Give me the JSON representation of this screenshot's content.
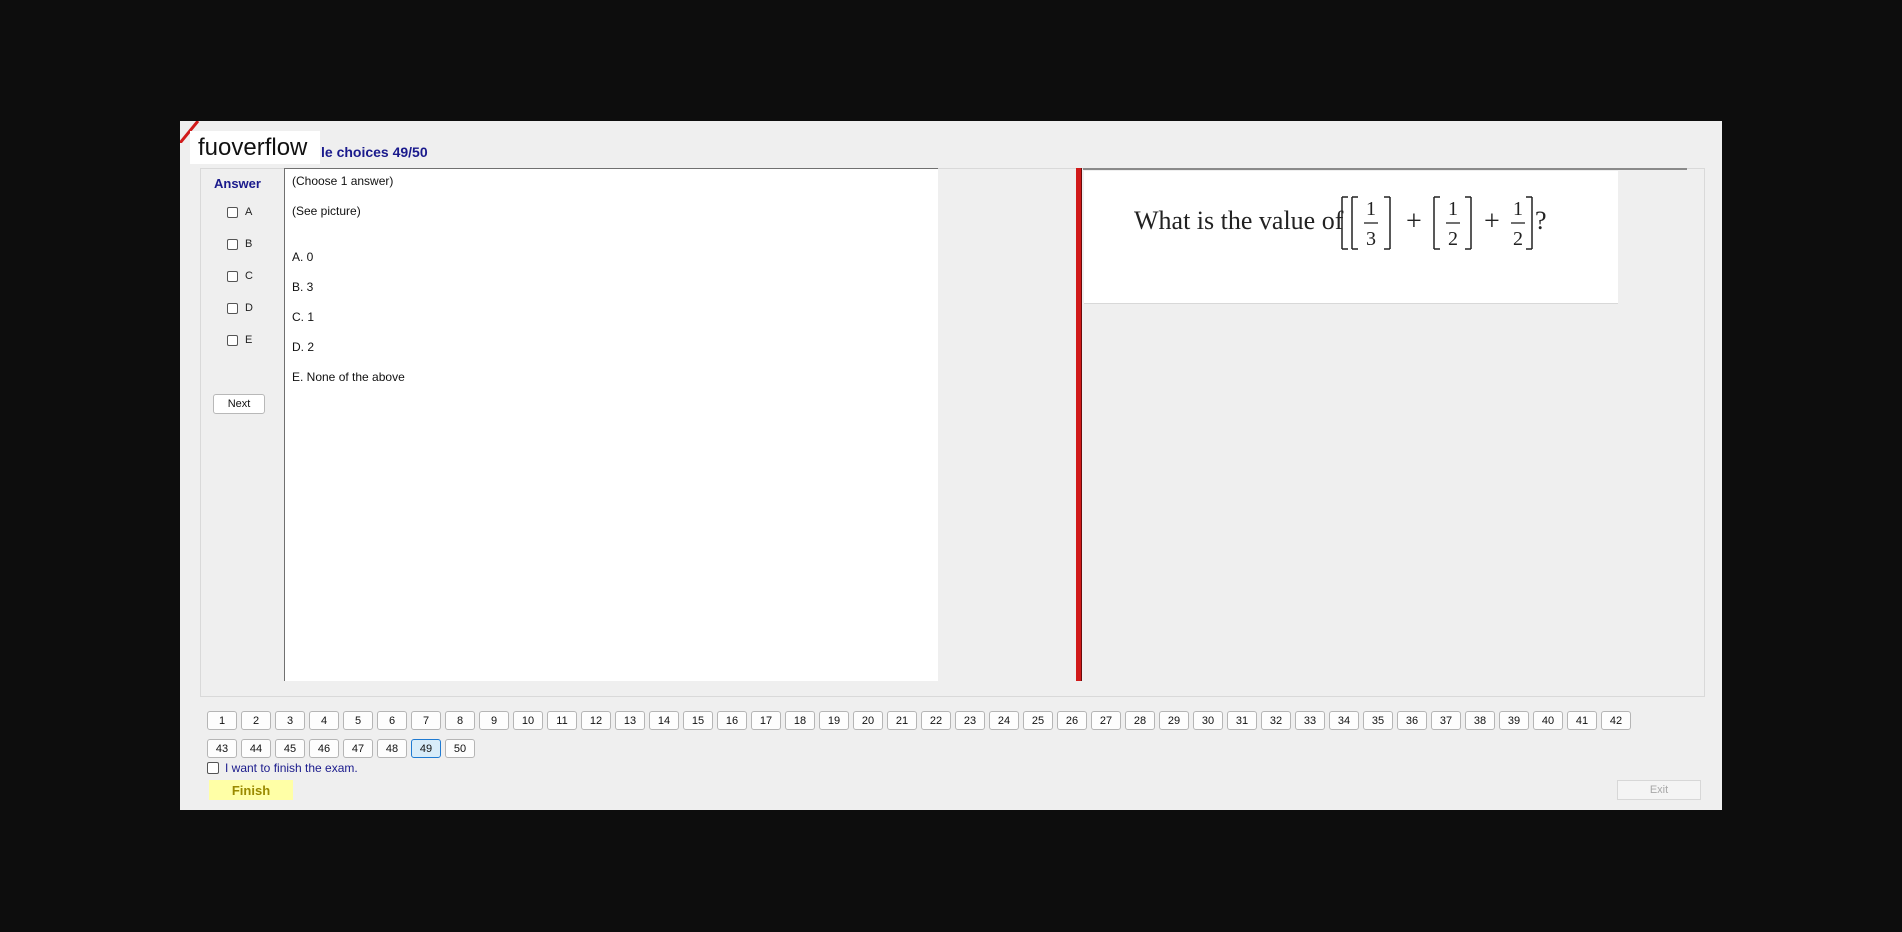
{
  "brand": {
    "text": "fuoverflow"
  },
  "header": {
    "title": "le choices 49/50"
  },
  "answer_panel": {
    "heading": "Answer",
    "options": [
      "A",
      "B",
      "C",
      "D",
      "E"
    ],
    "next_label": "Next"
  },
  "question": {
    "lines": [
      "(Choose 1 answer)",
      "(See picture)",
      "A.  0",
      "B.  3",
      "C.  1",
      "D.  2",
      "E.  None of the above"
    ]
  },
  "image": {
    "prefix": "What is the value of",
    "terms": [
      {
        "num": "1",
        "den": "3"
      },
      {
        "num": "1",
        "den": "2"
      },
      {
        "num": "1",
        "den": "2"
      }
    ],
    "plus": "+",
    "suffix": "?"
  },
  "navigation": {
    "numbers": [
      "1",
      "2",
      "3",
      "4",
      "5",
      "6",
      "7",
      "8",
      "9",
      "10",
      "11",
      "12",
      "13",
      "14",
      "15",
      "16",
      "17",
      "18",
      "19",
      "20",
      "21",
      "22",
      "23",
      "24",
      "25",
      "26",
      "27",
      "28",
      "29",
      "30",
      "31",
      "32",
      "33",
      "34",
      "35",
      "36",
      "37",
      "38",
      "39",
      "40",
      "41",
      "42",
      "43",
      "44",
      "45",
      "46",
      "47",
      "48",
      "49",
      "50"
    ],
    "current": "49"
  },
  "footer": {
    "finish_check_label": "I want to finish the exam.",
    "finish_label": "Finish",
    "exit_label": "Exit"
  },
  "colors": {
    "splitter": "#d11a1a",
    "title": "#1a1a8c",
    "finish_bg": "#ffffa6"
  }
}
